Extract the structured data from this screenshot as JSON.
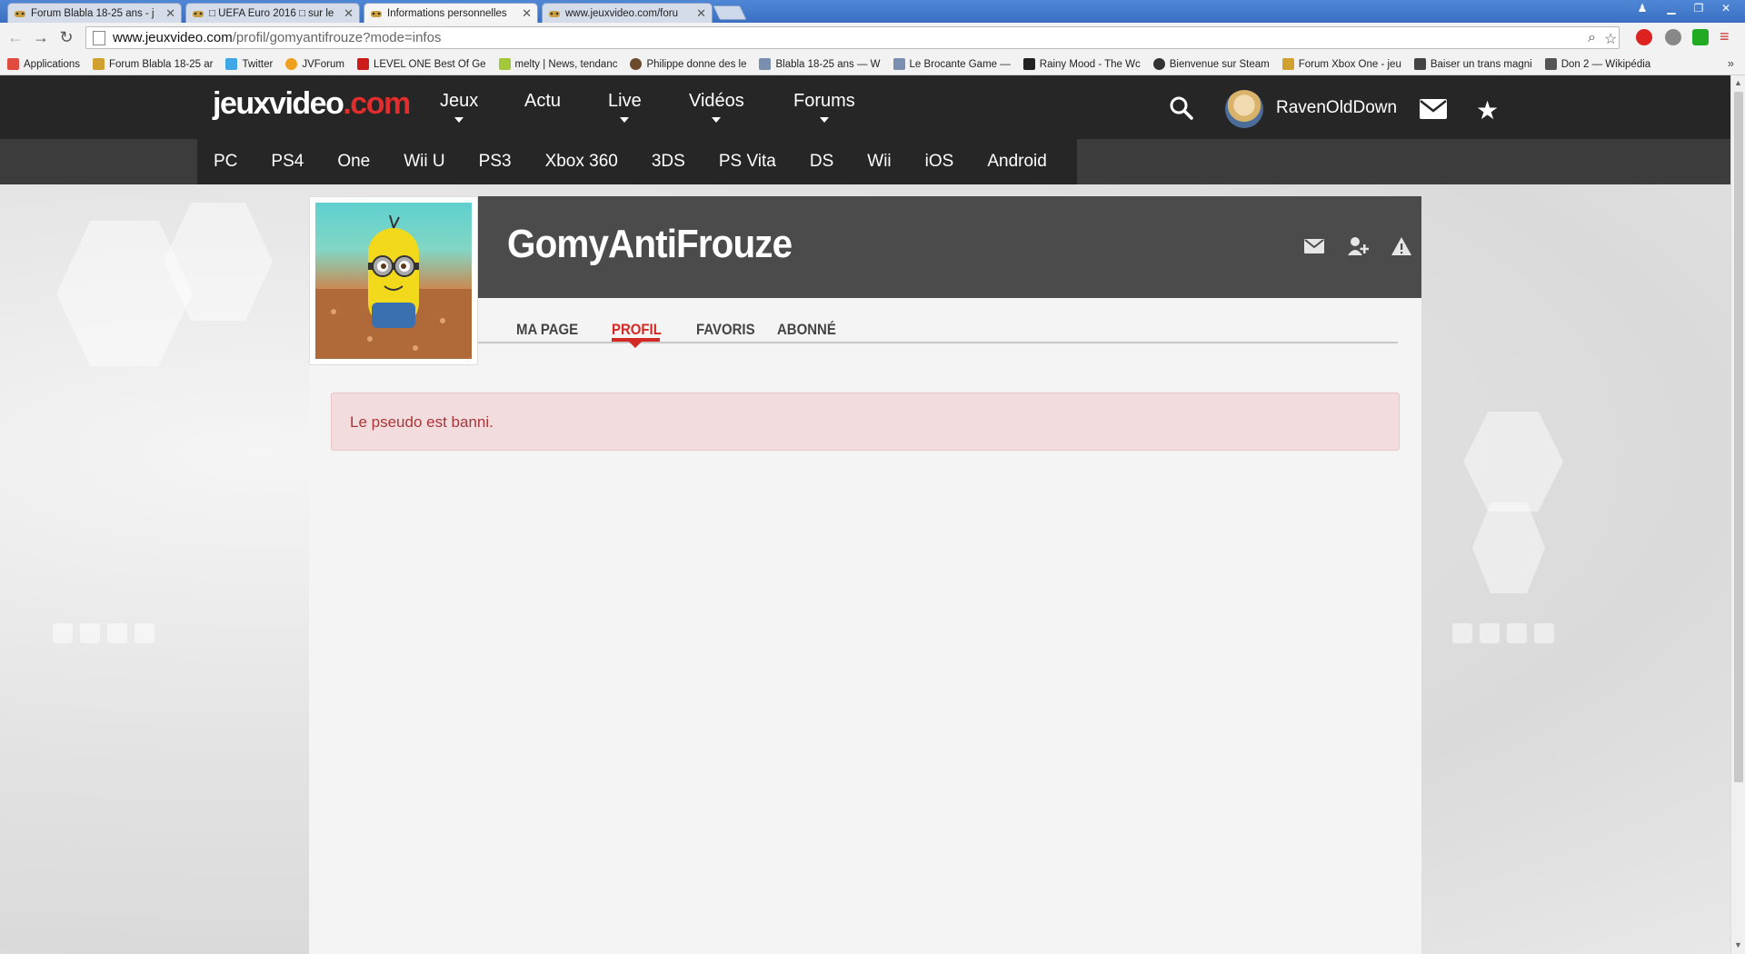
{
  "browser": {
    "tabs": [
      {
        "title": "Forum Blabla 18-25 ans - j",
        "active": false
      },
      {
        "title": "□ UEFA Euro 2016 □ sur le",
        "active": false
      },
      {
        "title": "Informations personnelles",
        "active": true
      },
      {
        "title": "www.jeuxvideo.com/foru",
        "active": false
      }
    ],
    "url_host": "www.jeuxvideo.com",
    "url_path": "/profil/gomyantifrouze?mode=infos",
    "bookmarks": [
      {
        "label": "Applications",
        "icon": "apps-grid-icon",
        "color": "#e04a3f"
      },
      {
        "label": "Forum Blabla 18-25 ar",
        "icon": "gamepad-icon",
        "color": "#d0a030"
      },
      {
        "label": "Twitter",
        "icon": "twitter-icon",
        "color": "#3fa7e6"
      },
      {
        "label": "JVForum",
        "icon": "chat-bubble-icon",
        "color": "#f0a020"
      },
      {
        "label": "LEVEL ONE Best Of Ge",
        "icon": "youtube-icon",
        "color": "#cc1b1b"
      },
      {
        "label": "melty | News, tendanc",
        "icon": "melty-icon",
        "color": "#a3c83a"
      },
      {
        "label": "Philippe donne des le",
        "icon": "person-icon",
        "color": "#6b4b2b"
      },
      {
        "label": "Blabla 18-25 ans — W",
        "icon": "rss-icon",
        "color": "#7a8fb0"
      },
      {
        "label": "Le Brocante Game —",
        "icon": "rss-icon",
        "color": "#7a8fb0"
      },
      {
        "label": "Rainy Mood - The Wc",
        "icon": "r-logo-icon",
        "color": "#222222"
      },
      {
        "label": "Bienvenue sur Steam",
        "icon": "steam-icon",
        "color": "#333333"
      },
      {
        "label": "Forum Xbox One - jeu",
        "icon": "gamepad-icon",
        "color": "#d0a030"
      },
      {
        "label": "Baiser un trans magni",
        "icon": "bag-icon",
        "color": "#444444"
      },
      {
        "label": "Don 2 — Wikipédia",
        "icon": "wikipedia-icon",
        "color": "#555555"
      }
    ]
  },
  "header": {
    "logo_main": "jeuxvideo",
    "logo_suffix": ".com",
    "nav": [
      "Jeux",
      "Actu",
      "Live",
      "Vidéos",
      "Forums"
    ],
    "username": "RavenOldDown"
  },
  "platforms": [
    "PC",
    "PS4",
    "One",
    "Wii U",
    "PS3",
    "Xbox 360",
    "3DS",
    "PS Vita",
    "DS",
    "Wii",
    "iOS",
    "Android"
  ],
  "profile": {
    "name": "GomyAntiFrouze",
    "tabs": [
      "MA PAGE",
      "PROFIL",
      "FAVORIS",
      "ABONNÉ"
    ],
    "active_tab": "PROFIL",
    "alert": "Le pseudo est banni."
  },
  "colors": {
    "brand_red": "#e12d2d",
    "header_bg": "#262626",
    "alert_bg": "#f2dcde",
    "alert_text": "#a8363a"
  }
}
